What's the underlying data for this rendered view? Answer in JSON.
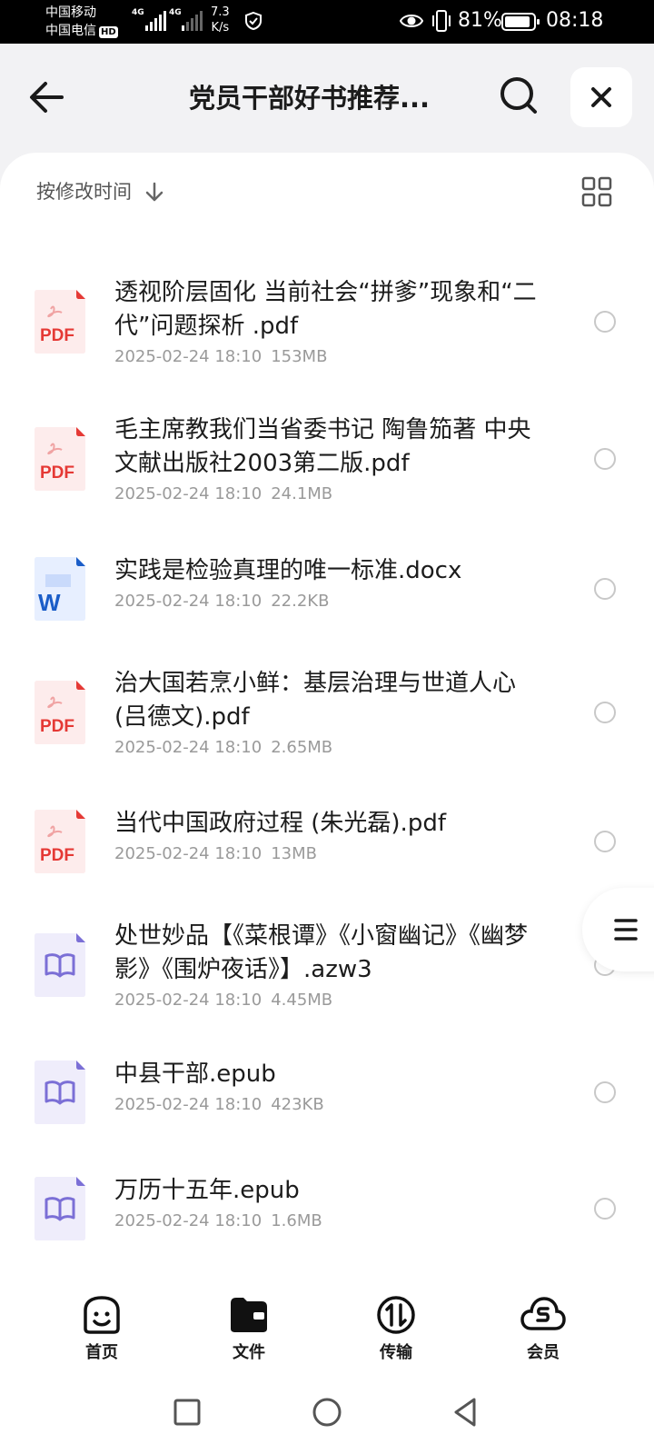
{
  "status_bar": {
    "carrier1": "中国移动",
    "carrier2": "中国电信",
    "hd": "HD",
    "net1": "4G",
    "net2": "4G",
    "speed_value": "7.3",
    "speed_unit": "K/s",
    "battery": "81%",
    "time": "08:18"
  },
  "header": {
    "title": "党员干部好书推荐..."
  },
  "toolbar": {
    "sort_label": "按修改时间"
  },
  "files": [
    {
      "name": "透视阶层固化 当前社会“拼爹”现象和“二代”问题探析 .pdf",
      "date": "2025-02-24 18:10",
      "size": "153MB",
      "type": "pdf",
      "type_label": "PDF"
    },
    {
      "name": "毛主席教我们当省委书记  陶鲁笳著 中央文献出版社2003第二版.pdf",
      "date": "2025-02-24 18:10",
      "size": "24.1MB",
      "type": "pdf",
      "type_label": "PDF"
    },
    {
      "name": "实践是检验真理的唯一标准.docx",
      "date": "2025-02-24 18:10",
      "size": "22.2KB",
      "type": "docx",
      "type_label": "W"
    },
    {
      "name": "治大国若烹小鲜：基层治理与世道人心 (吕德文).pdf",
      "date": "2025-02-24 18:10",
      "size": "2.65MB",
      "type": "pdf",
      "type_label": "PDF"
    },
    {
      "name": "当代中国政府过程 (朱光磊).pdf",
      "date": "2025-02-24 18:10",
      "size": "13MB",
      "type": "pdf",
      "type_label": "PDF"
    },
    {
      "name": "处世妙品【《菜根谭》《小窗幽记》《幽梦影》《围炉夜话》】.azw3",
      "date": "2025-02-24 18:10",
      "size": "4.45MB",
      "type": "ebook",
      "type_label": ""
    },
    {
      "name": "中县干部.epub",
      "date": "2025-02-24 18:10",
      "size": "423KB",
      "type": "ebook",
      "type_label": ""
    },
    {
      "name": "万历十五年.epub",
      "date": "2025-02-24 18:10",
      "size": "1.6MB",
      "type": "ebook",
      "type_label": ""
    }
  ],
  "bottom_nav": [
    {
      "label": "首页",
      "icon": "smiley-icon"
    },
    {
      "label": "文件",
      "icon": "folder-icon"
    },
    {
      "label": "传输",
      "icon": "transfer-icon"
    },
    {
      "label": "会员",
      "icon": "cloud-vip-icon"
    }
  ],
  "colors": {
    "pdf_red": "#e53935",
    "word_blue": "#1a5dc8",
    "ebook_purple": "#7b6fd6",
    "background": "#f2f2f4"
  }
}
